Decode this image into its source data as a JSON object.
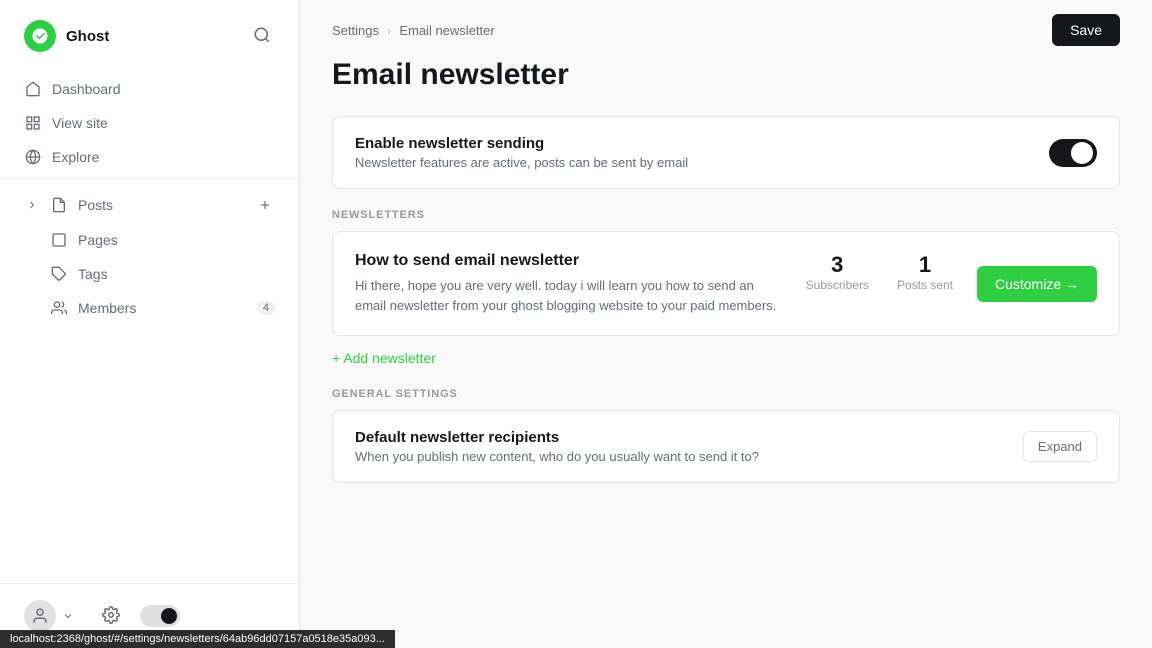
{
  "brand": {
    "name": "Ghost"
  },
  "sidebar": {
    "nav": [
      {
        "id": "dashboard",
        "label": "Dashboard",
        "icon": "home"
      },
      {
        "id": "view-site",
        "label": "View site",
        "icon": "grid"
      },
      {
        "id": "explore",
        "label": "Explore",
        "icon": "globe"
      }
    ],
    "content": [
      {
        "id": "posts",
        "label": "Posts",
        "icon": "file",
        "badge": ""
      },
      {
        "id": "pages",
        "label": "Pages",
        "icon": "page",
        "badge": ""
      },
      {
        "id": "tags",
        "label": "Tags",
        "icon": "tag",
        "badge": ""
      },
      {
        "id": "members",
        "label": "Members",
        "icon": "members",
        "badge": "4"
      }
    ]
  },
  "breadcrumb": {
    "parent": "Settings",
    "separator": "›",
    "current": "Email newsletter"
  },
  "toolbar": {
    "save_label": "Save"
  },
  "page": {
    "title": "Email newsletter"
  },
  "enable_newsletter": {
    "label": "Enable newsletter sending",
    "description": "Newsletter features are active, posts can be sent by email",
    "enabled": true
  },
  "newsletters_section": {
    "label": "NEWSLETTERS",
    "add_label": "+ Add newsletter"
  },
  "newsletter": {
    "title": "How to send email newsletter",
    "description": "Hi there, hope you are very well. today i will learn you how to send an email newsletter from your ghost blogging website to your paid members.",
    "subscribers": {
      "value": "3",
      "label": "Subscribers"
    },
    "posts_sent": {
      "value": "1",
      "label": "Posts sent"
    },
    "customize_label": "Customize →"
  },
  "general_settings": {
    "label": "GENERAL SETTINGS",
    "default_recipients": {
      "label": "Default newsletter recipients",
      "description": "When you publish new content, who do you usually want to send it to?",
      "expand_label": "Expand"
    }
  },
  "status_bar": {
    "url": "localhost:2368/ghost/#/settings/newsletters/64ab96dd07157a0518e35a093..."
  }
}
